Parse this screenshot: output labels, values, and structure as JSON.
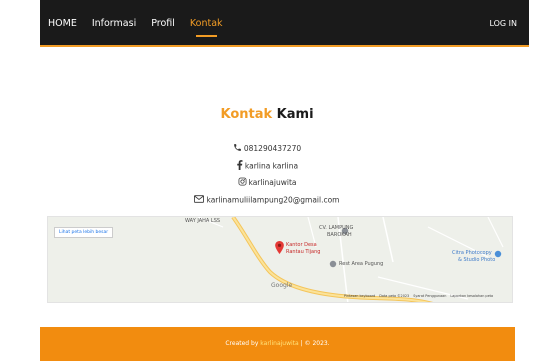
{
  "nav": {
    "items": [
      {
        "label": "HOME",
        "active": false
      },
      {
        "label": "Informasi",
        "active": false
      },
      {
        "label": "Profil",
        "active": false
      },
      {
        "label": "Kontak",
        "active": true
      }
    ],
    "login_label": "LOG IN"
  },
  "heading": {
    "accent": "Kontak",
    "rest": "Kami"
  },
  "contacts": {
    "phone": "081290437270",
    "facebook": "karlina karlina",
    "instagram": "karlinajuwita",
    "email": "karlinamuliilampung20@gmail.com"
  },
  "map": {
    "view_larger": "Lihat peta lebih besar",
    "labels": {
      "way_jaha": "WAY JAHA LSS",
      "cv_line1": "CV. LAMPUNG",
      "cv_line2": "BAROKAH",
      "kantor_line1": "Kantor Desa",
      "kantor_line2": "Rantau Tijang",
      "rest_area": "Rest Area Pugung",
      "citra_line1": "Citra Photocopy",
      "citra_line2": "& Studio Photo"
    },
    "google": "Google",
    "footer": {
      "shortcuts": "Pintasan keyboard",
      "map_data": "Data peta ©2023",
      "terms": "Syarat Penggunaan",
      "report": "Laporkan kesalahan peta"
    }
  },
  "footer": {
    "prefix": "Created by",
    "author": "karlinajuwita",
    "suffix": "| © 2023."
  },
  "colors": {
    "accent": "#f29c25",
    "navbar": "#1a1a1a",
    "footer": "#f28c0f"
  }
}
